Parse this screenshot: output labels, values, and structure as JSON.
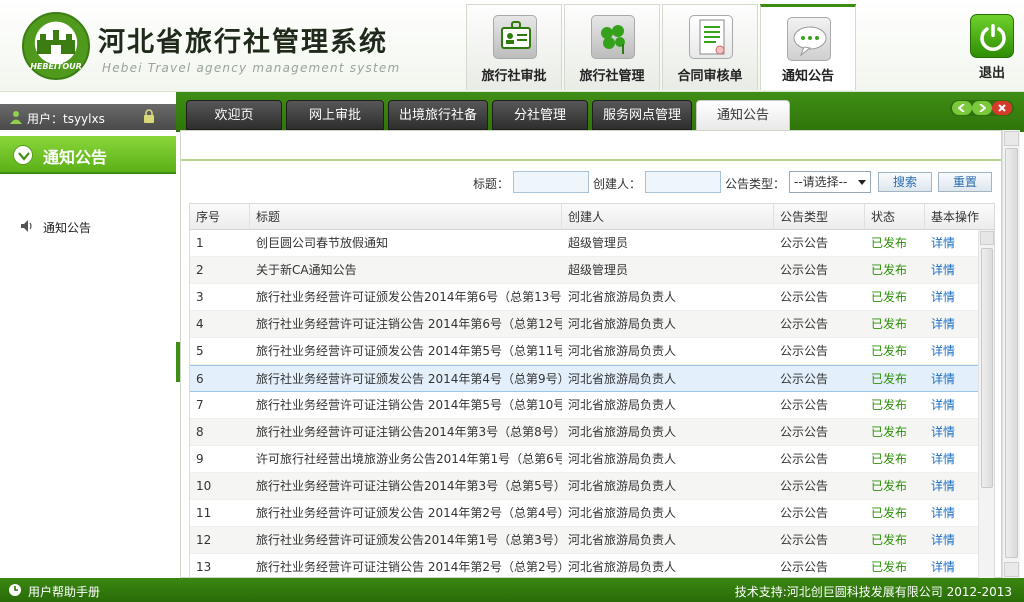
{
  "header": {
    "title": "河北省旅行社管理系统",
    "subtitle": "Hebei Travel agency management system",
    "logo_text": "HEBEITOUR",
    "nav": [
      {
        "label": "旅行社审批",
        "icon": "id-card-icon"
      },
      {
        "label": "旅行社管理",
        "icon": "clover-icon"
      },
      {
        "label": "合同审核单",
        "icon": "document-icon"
      },
      {
        "label": "通知公告",
        "icon": "chat-bubble-icon"
      }
    ],
    "active_nav": "通知公告",
    "logout_label": "退出"
  },
  "sidebar": {
    "user_text": "用户：tsyylxs",
    "section_title": "通知公告",
    "items": [
      {
        "label": "通知公告",
        "icon": "speaker-icon"
      }
    ]
  },
  "tabs": [
    {
      "label": "欢迎页"
    },
    {
      "label": "网上审批"
    },
    {
      "label": "出境旅行社备"
    },
    {
      "label": "分社管理"
    },
    {
      "label": "服务网点管理"
    },
    {
      "label": "通知公告"
    }
  ],
  "active_tab": "通知公告",
  "filter": {
    "title_label": "标题：",
    "creator_label": "创建人：",
    "type_label": "公告类型：",
    "type_selected": "--请选择--",
    "search_label": "搜索",
    "reset_label": "重置"
  },
  "table": {
    "columns": [
      "序号",
      "标题",
      "创建人",
      "公告类型",
      "状态",
      "基本操作"
    ],
    "rows": [
      {
        "no": "1",
        "title": "创巨圆公司春节放假通知",
        "creator": "超级管理员",
        "type": "公示公告",
        "status": "已发布",
        "action": "详情"
      },
      {
        "no": "2",
        "title": "关于新CA通知公告",
        "creator": "超级管理员",
        "type": "公示公告",
        "status": "已发布",
        "action": "详情"
      },
      {
        "no": "3",
        "title": "旅行社业务经营许可证颁发公告2014年第6号（总第13号",
        "creator": "河北省旅游局负责人",
        "type": "公示公告",
        "status": "已发布",
        "action": "详情"
      },
      {
        "no": "4",
        "title": "旅行社业务经营许可证注销公告 2014年第6号（总第12号",
        "creator": "河北省旅游局负责人",
        "type": "公示公告",
        "status": "已发布",
        "action": "详情"
      },
      {
        "no": "5",
        "title": "旅行社业务经营许可证颁发公告 2014年第5号（总第11号",
        "creator": "河北省旅游局负责人",
        "type": "公示公告",
        "status": "已发布",
        "action": "详情"
      },
      {
        "no": "6",
        "title": "旅行社业务经营许可证颁发公告 2014年第4号（总第9号）",
        "creator": "河北省旅游局负责人",
        "type": "公示公告",
        "status": "已发布",
        "action": "详情"
      },
      {
        "no": "7",
        "title": "旅行社业务经营许可证注销公告 2014年第5号（总第10号",
        "creator": "河北省旅游局负责人",
        "type": "公示公告",
        "status": "已发布",
        "action": "详情"
      },
      {
        "no": "8",
        "title": "旅行社业务经营许可证注销公告2014年第3号（总第8号）",
        "creator": "河北省旅游局负责人",
        "type": "公示公告",
        "status": "已发布",
        "action": "详情"
      },
      {
        "no": "9",
        "title": "许可旅行社经营出境旅游业务公告2014年第1号（总第6号",
        "creator": "河北省旅游局负责人",
        "type": "公示公告",
        "status": "已发布",
        "action": "详情"
      },
      {
        "no": "10",
        "title": "旅行社业务经营许可证注销公告2014年第3号（总第5号）",
        "creator": "河北省旅游局负责人",
        "type": "公示公告",
        "status": "已发布",
        "action": "详情"
      },
      {
        "no": "11",
        "title": "旅行社业务经营许可证颁发公告 2014年第2号（总第4号）",
        "creator": "河北省旅游局负责人",
        "type": "公示公告",
        "status": "已发布",
        "action": "详情"
      },
      {
        "no": "12",
        "title": "旅行社业务经营许可证颁发公告2014年第1号（总第3号）",
        "creator": "河北省旅游局负责人",
        "type": "公示公告",
        "status": "已发布",
        "action": "详情"
      },
      {
        "no": "13",
        "title": "旅行社业务经营许可证注销公告 2014年第2号（总第2号）",
        "creator": "河北省旅游局负责人",
        "type": "公示公告",
        "status": "已发布",
        "action": "详情"
      }
    ],
    "selected_row": "6"
  },
  "footer": {
    "help_label": "用户帮助手册",
    "copyright": "技术支持:河北创巨圆科技发展有限公司 2012-2013"
  },
  "colors": {
    "primary_green": "#3c8d0f",
    "status_green": "#2f8f0a",
    "link_blue": "#1d6fc4"
  }
}
